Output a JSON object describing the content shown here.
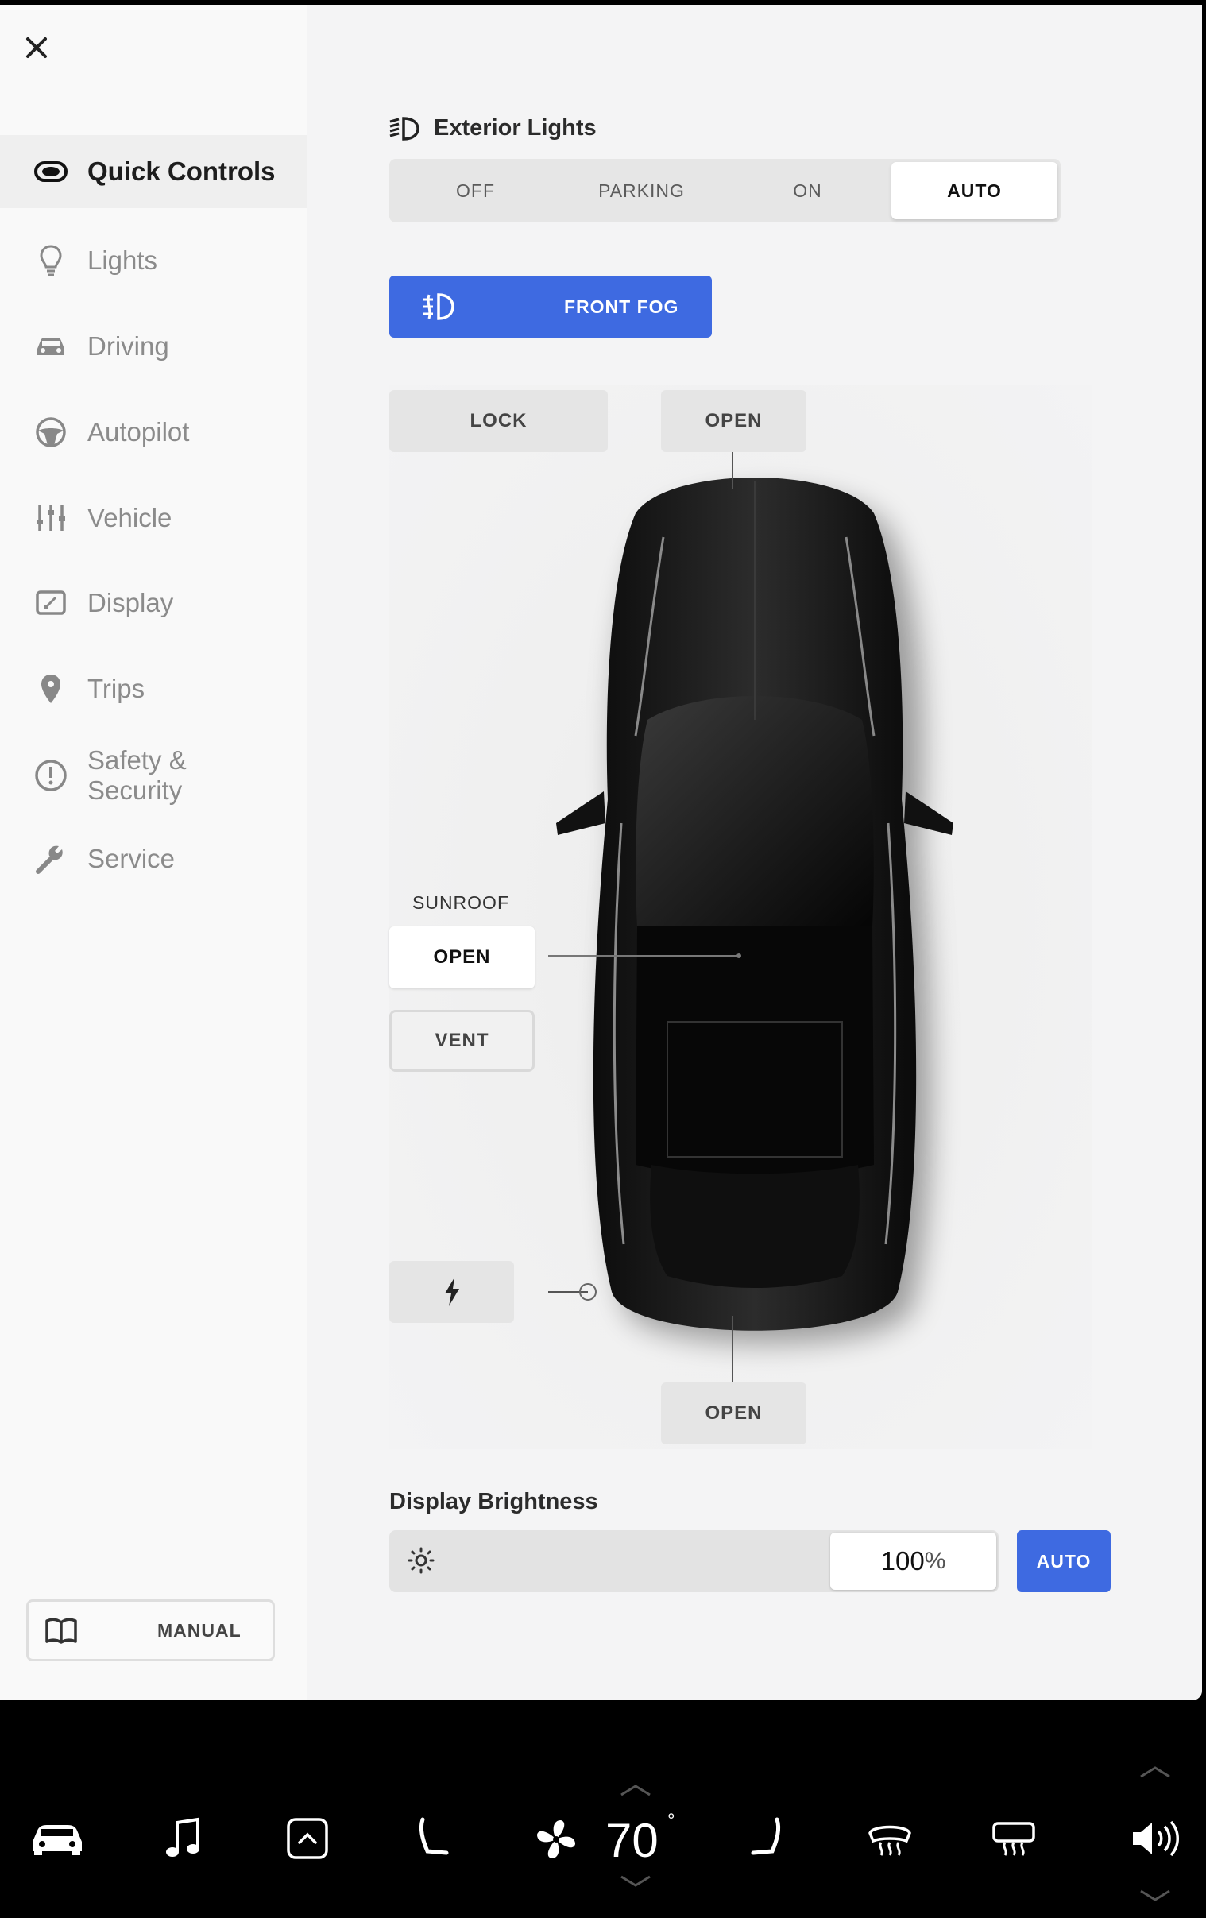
{
  "sidebar": {
    "close_icon": "close-icon",
    "items": [
      {
        "label": "Quick Controls",
        "icon": "quick-controls-icon",
        "active": true
      },
      {
        "label": "Lights",
        "icon": "bulb-icon"
      },
      {
        "label": "Driving",
        "icon": "car-icon"
      },
      {
        "label": "Autopilot",
        "icon": "steering-wheel-icon"
      },
      {
        "label": "Vehicle",
        "icon": "sliders-icon"
      },
      {
        "label": "Display",
        "icon": "display-icon"
      },
      {
        "label": "Trips",
        "icon": "location-pin-icon"
      },
      {
        "label": "Safety &\nSecurity",
        "icon": "alert-circle-icon"
      },
      {
        "label": "Service",
        "icon": "wrench-icon"
      }
    ],
    "manual_label": "MANUAL"
  },
  "exterior_lights": {
    "title": "Exterior Lights",
    "options": [
      "OFF",
      "PARKING",
      "ON",
      "AUTO"
    ],
    "selected": "AUTO"
  },
  "front_fog": {
    "label": "FRONT FOG",
    "active": true
  },
  "car_controls": {
    "lock_label": "LOCK",
    "frunk_label": "OPEN",
    "trunk_label": "OPEN",
    "sunroof_title": "SUNROOF",
    "sunroof_open_label": "OPEN",
    "sunroof_vent_label": "VENT",
    "charge_port_icon": "lightning-icon"
  },
  "display_brightness": {
    "title": "Display Brightness",
    "value": "100",
    "unit": "%",
    "level": 1.0,
    "auto_label": "AUTO"
  },
  "taskbar": {
    "temperature": "70",
    "degree": "°",
    "icons": [
      "car-icon",
      "music-note-icon",
      "app-launcher-icon",
      "driver-seat-icon",
      "fan-icon",
      "passenger-seat-icon",
      "rear-defrost-icon",
      "front-defrost-icon",
      "volume-icon"
    ]
  },
  "colors": {
    "accent": "#3e6ae1",
    "panel_bg": "#f4f4f5",
    "sidebar_bg": "#f9f9f9"
  }
}
